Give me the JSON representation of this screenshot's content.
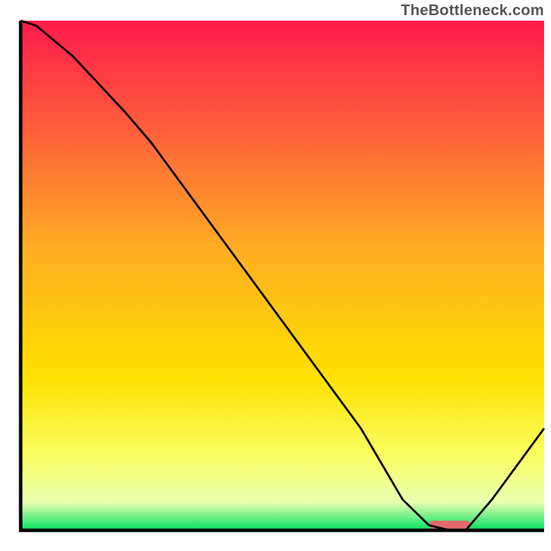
{
  "watermark": "TheBottleneck.com",
  "colors": {
    "axis": "#000000",
    "curve": "#000000",
    "marker": "#e26a6a",
    "gradient_stops": [
      {
        "offset": 0.0,
        "color": "#ff1a4b"
      },
      {
        "offset": 0.2,
        "color": "#ff5a3c"
      },
      {
        "offset": 0.45,
        "color": "#ffae22"
      },
      {
        "offset": 0.7,
        "color": "#ffe100"
      },
      {
        "offset": 0.86,
        "color": "#f8ff66"
      },
      {
        "offset": 0.945,
        "color": "#e8ffb0"
      },
      {
        "offset": 1.0,
        "color": "#00e060"
      }
    ]
  },
  "chart_data": {
    "type": "line",
    "title": "",
    "xlabel": "",
    "ylabel": "",
    "xlim": [
      0,
      100
    ],
    "ylim": [
      0,
      100
    ],
    "x": [
      0,
      3,
      10,
      20,
      25,
      35,
      50,
      65,
      73,
      78,
      82,
      85,
      90,
      100
    ],
    "values": [
      100,
      99,
      93,
      82,
      76,
      62,
      41,
      20,
      6,
      1,
      0,
      0,
      6,
      20
    ],
    "marker": {
      "x_start": 78,
      "x_end": 86,
      "y": 0
    }
  }
}
